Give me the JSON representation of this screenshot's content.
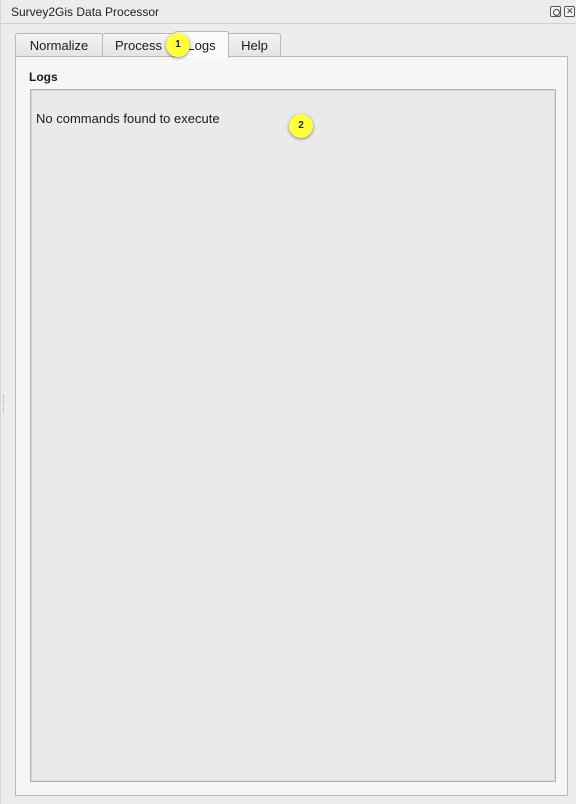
{
  "window": {
    "title": "Survey2Gis Data Processor"
  },
  "tabs": [
    {
      "label": "Normalize",
      "active": false
    },
    {
      "label": "Process",
      "active": false
    },
    {
      "label": "Logs",
      "active": true
    },
    {
      "label": "Help",
      "active": false
    }
  ],
  "logs": {
    "section_label": "Logs",
    "message": "No commands found to execute"
  },
  "markers": [
    "1",
    "2"
  ],
  "colors": {
    "marker": "#ffff3c"
  }
}
